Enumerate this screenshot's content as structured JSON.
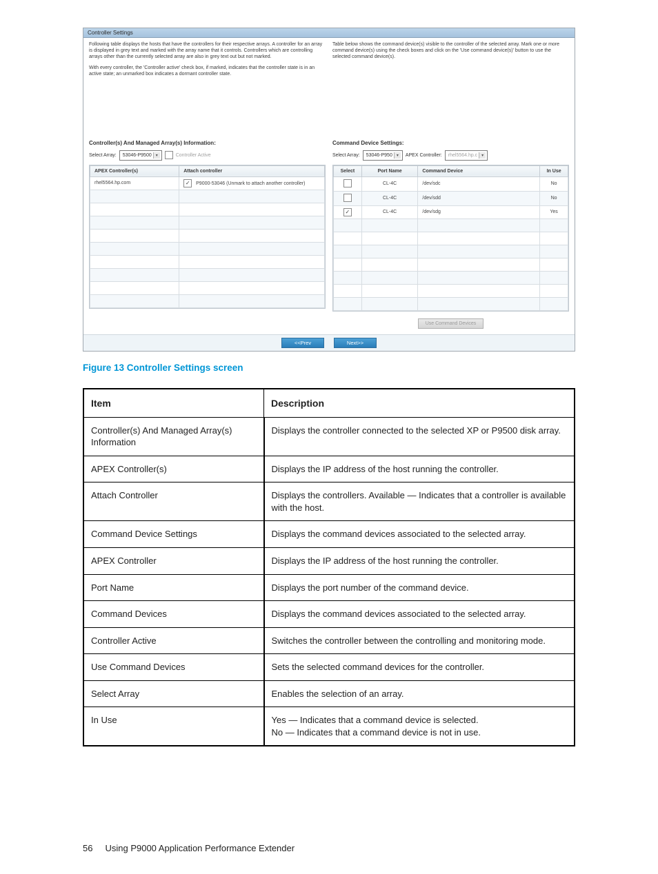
{
  "panel": {
    "title": "Controller Settings",
    "left_instr_p1": "Following table displays the hosts that have the controllers for their respective arrays. A controller for an array is displayed in grey text and marked with the array name that it controls. Controllers which are controlling arrays other than the currently selected array are also in grey text out but not marked.",
    "left_instr_p2": "With every controller, the 'Controller active' check box, if marked, indicates that the controller state is in an active state; an unmarked box indicates a dormant controller state.",
    "right_instr": "Table below shows the command device(s) visible to the controller of the selected array. Mark one or more command device(s) using the check boxes and click on the 'Use command device(s)' button to use the selected command device(s).",
    "left_section_heading": "Controller(s) And Managed Array(s) Information:",
    "right_section_heading": "Command Device Settings:",
    "select_array_label": "Select Array:",
    "left_array_value": "53046-P9500",
    "controller_active_label": "Controller Active",
    "right_array_value": "53046-P950",
    "apex_controller_label": "APEX Controller:",
    "apex_controller_value": "rhel5564.hp.c",
    "left_table": {
      "h1": "APEX Controller(s)",
      "h2": "Attach controller",
      "r1c1": "rhel5564.hp.com",
      "r1c2": "P9000-53046 (Unmark to attach another controller)"
    },
    "right_table": {
      "h1": "Select",
      "h2": "Port Name",
      "h3": "Command Device",
      "h4": "In Use",
      "rows": [
        {
          "port": "CL-4C",
          "dev": "/dev/sdc",
          "inuse": "No",
          "checked": false
        },
        {
          "port": "CL-4C",
          "dev": "/dev/sdd",
          "inuse": "No",
          "checked": false
        },
        {
          "port": "CL-4C",
          "dev": "/dev/sdg",
          "inuse": "Yes",
          "checked": true
        }
      ]
    },
    "use_button": "Use Command Devices",
    "prev_button": "<<Prev",
    "next_button": "Next>>"
  },
  "figure_caption": "Figure 13 Controller Settings screen",
  "doctable": {
    "h_item": "Item",
    "h_desc": "Description",
    "rows": [
      {
        "item": "Controller(s) And Managed Array(s) Information",
        "desc": "Displays the controller connected to the selected XP or P9500 disk array."
      },
      {
        "item": "APEX Controller(s)",
        "desc": "Displays the IP address of the host running the controller."
      },
      {
        "item": "Attach Controller",
        "desc": "Displays the controllers. Available — Indicates that a controller is available with the host."
      },
      {
        "item": "Command Device Settings",
        "desc": "Displays the command devices associated to the selected array."
      },
      {
        "item": "APEX Controller",
        "desc": "Displays the IP address of the host running the controller."
      },
      {
        "item": "Port Name",
        "desc": "Displays the port number of the command device."
      },
      {
        "item": "Command Devices",
        "desc": "Displays the command devices associated to the selected array."
      },
      {
        "item": "Controller Active",
        "desc": "Switches the controller between the controlling and monitoring mode."
      },
      {
        "item": "Use Command Devices",
        "desc": "Sets the selected command devices for the controller."
      },
      {
        "item": "Select Array",
        "desc": "Enables the selection of an array."
      },
      {
        "item": "In Use",
        "desc": "Yes — Indicates that a command device is selected.\nNo — Indicates that a command device is not in use."
      }
    ]
  },
  "footer": {
    "page": "56",
    "text": "Using P9000 Application Performance Extender"
  }
}
